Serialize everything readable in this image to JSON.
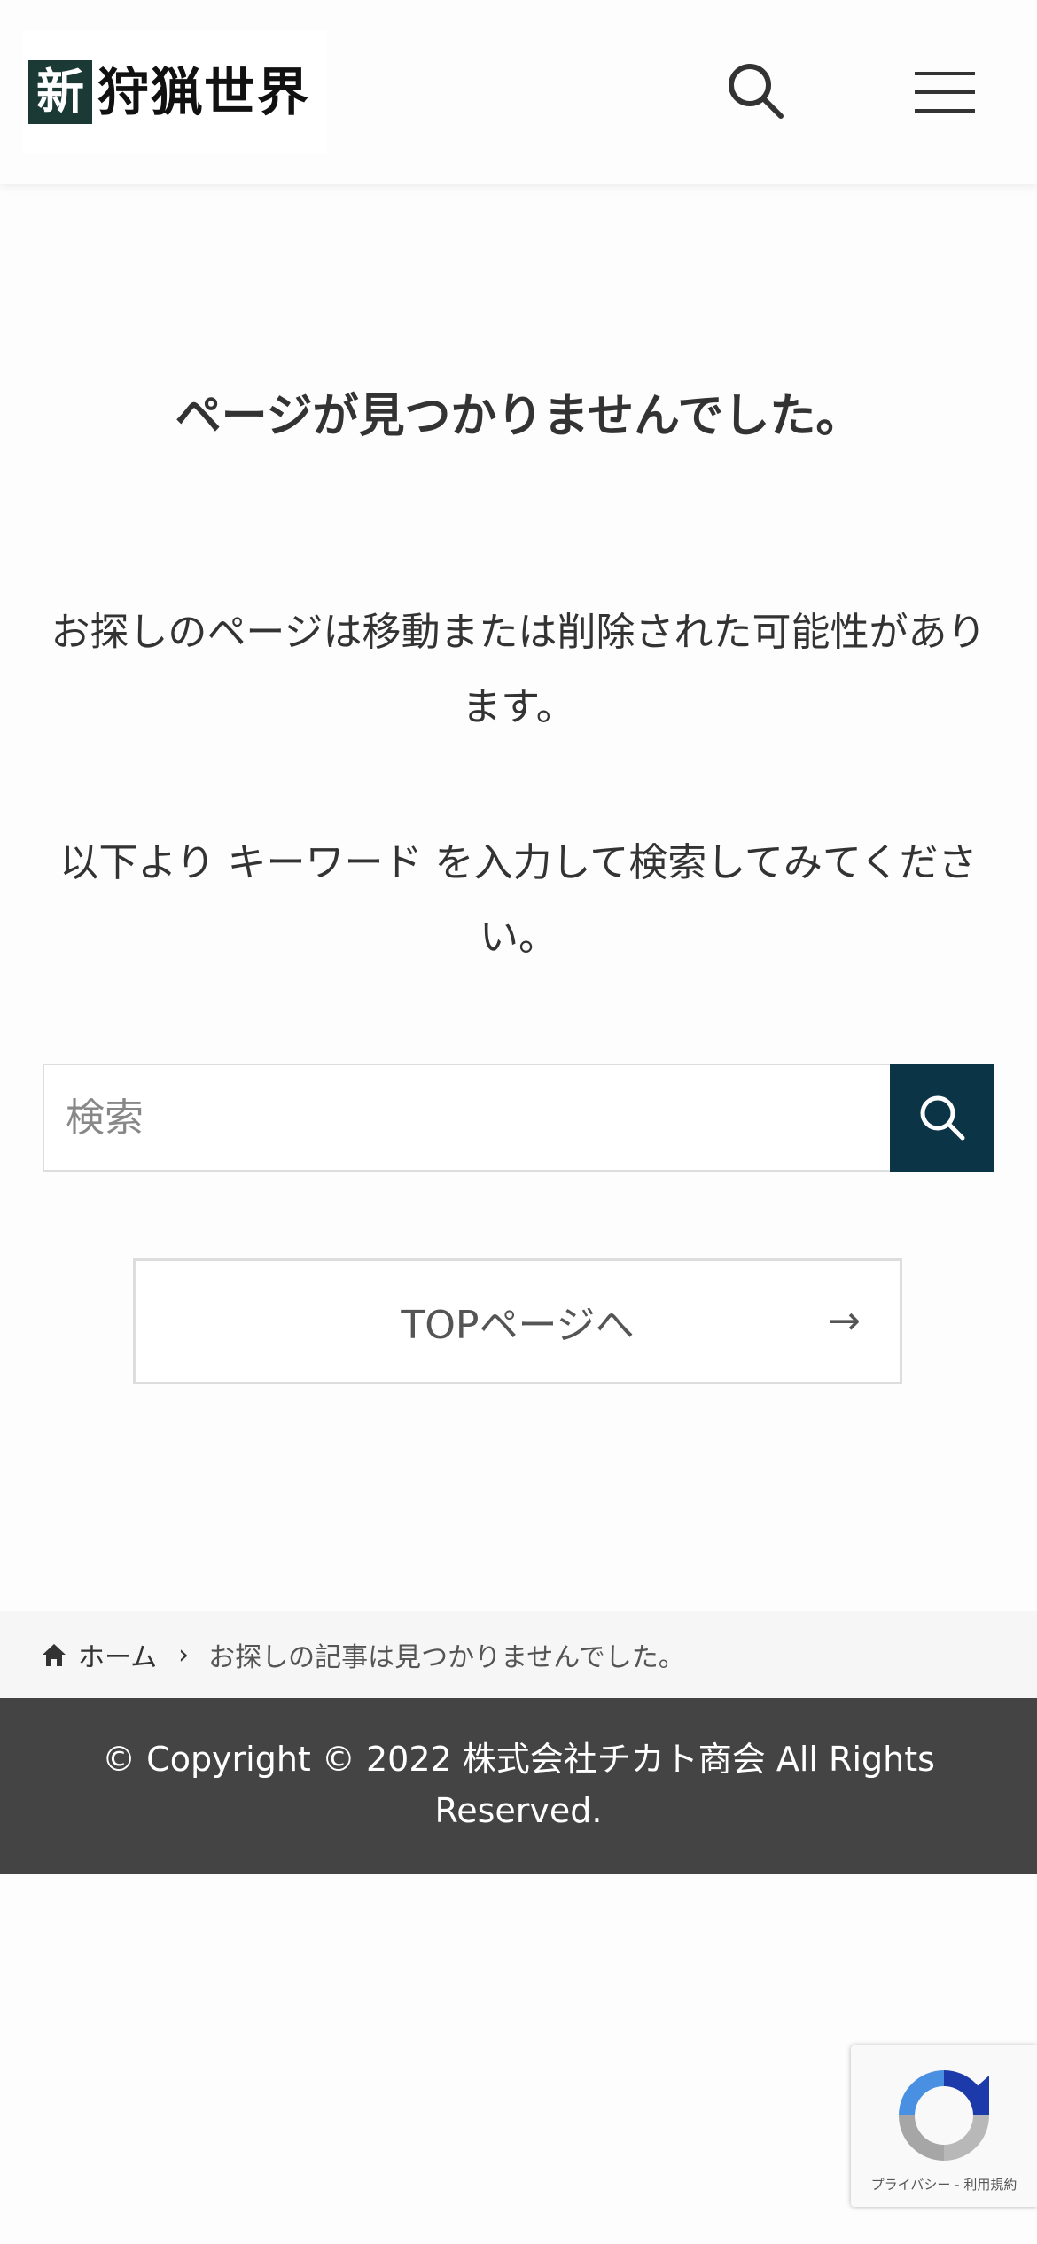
{
  "header": {
    "logo_badge": "新",
    "logo_text": "狩猟世界",
    "search_icon": "search-icon",
    "menu_icon": "hamburger-menu-icon"
  },
  "main": {
    "title": "ページが見つかりませんでした。",
    "message": "お探しのページは移動または削除された可能性があります。",
    "instruction": "以下より キーワード を入力して検索してみてください。",
    "search": {
      "placeholder": "検索",
      "value": "",
      "submit_icon": "search-icon"
    },
    "top_button": {
      "label": "TOPページへ",
      "arrow": "→"
    }
  },
  "breadcrumb": {
    "home_icon": "home-icon",
    "home_label": "ホーム",
    "separator": "›",
    "current": "お探しの記事は見つかりませんでした。"
  },
  "footer": {
    "copyright": "© Copyright © 2022 株式会社チカト商会 All Rights Reserved."
  },
  "recaptcha": {
    "links": "プライバシー - 利用規約"
  },
  "colors": {
    "accent": "#0b3446",
    "logo_badge": "#1c3a35",
    "footer_bg": "#444444",
    "breadcrumb_bg": "#f6f6f6"
  }
}
